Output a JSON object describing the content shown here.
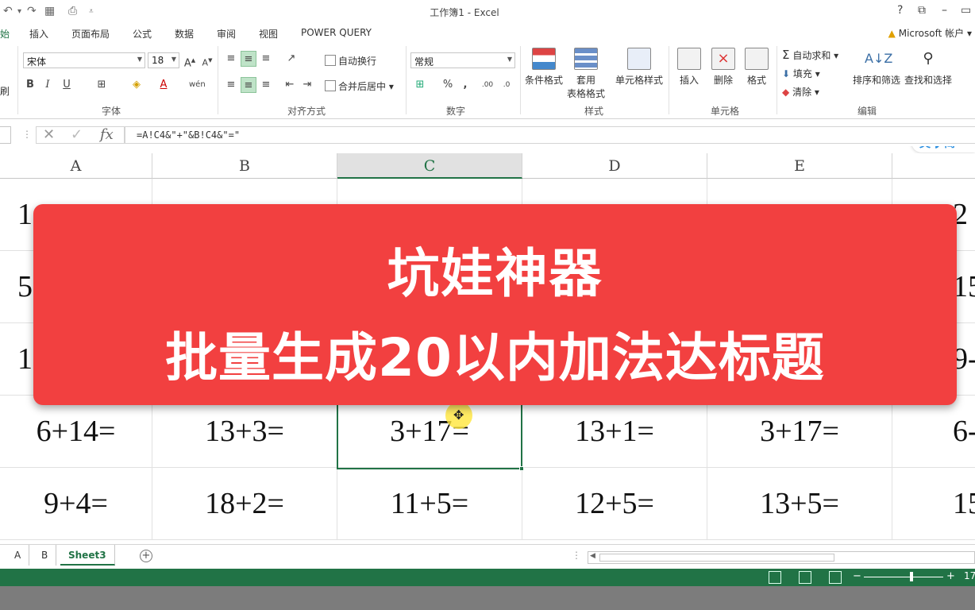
{
  "window": {
    "title": "工作簿1 - Excel",
    "help": "?",
    "restore": "⧉",
    "minimize": "–"
  },
  "tabs": [
    "始",
    "插入",
    "页面布局",
    "公式",
    "数据",
    "审阅",
    "视图",
    "POWER QUERY"
  ],
  "account": "Microsoft 帐户",
  "ribbon": {
    "clipboard_brush": "刷",
    "font_name": "宋体",
    "font_size": "18",
    "font_group": "字体",
    "wrap_text": "自动换行",
    "merge_center": "合并后居中",
    "align_group": "对齐方式",
    "number_format": "常规",
    "number_group": "数字",
    "conditional_format": "条件格式",
    "table_format_1": "套用",
    "table_format_2": "表格格式",
    "cell_styles": "单元格样式",
    "styles_group": "样式",
    "insert": "插入",
    "delete": "删除",
    "format": "格式",
    "cells_group": "单元格",
    "autosum": "自动求和",
    "fill": "填充",
    "clear": "清除",
    "sort_filter": "排序和筛选",
    "find_select": "查找和选择",
    "editing_group": "编辑",
    "ime": "英 ◗ 简"
  },
  "formula_bar": {
    "formula": "=A!C4&\"+\"&B!C4&\"=\""
  },
  "columns": [
    "A",
    "B",
    "C",
    "D",
    "E"
  ],
  "active_column": "C",
  "rows": [
    [
      "1",
      "",
      "",
      "",
      "",
      "2"
    ],
    [
      "5",
      "",
      "",
      "",
      "",
      "15"
    ],
    [
      "1",
      "",
      "",
      "",
      "",
      "9-"
    ],
    [
      "6+14=",
      "13+3=",
      "3+17=",
      "13+1=",
      "3+17=",
      "6-"
    ],
    [
      "9+4=",
      "18+2=",
      "11+5=",
      "12+5=",
      "13+5=",
      "15"
    ]
  ],
  "banner": {
    "line1": "坑娃神器",
    "line2": "批量生成20以内加法达标题",
    "color": "#f24040"
  },
  "sheets": [
    "A",
    "B",
    "Sheet3"
  ],
  "active_sheet": "Sheet3",
  "status": {
    "zoom_label": "17",
    "accent": "#217346"
  }
}
